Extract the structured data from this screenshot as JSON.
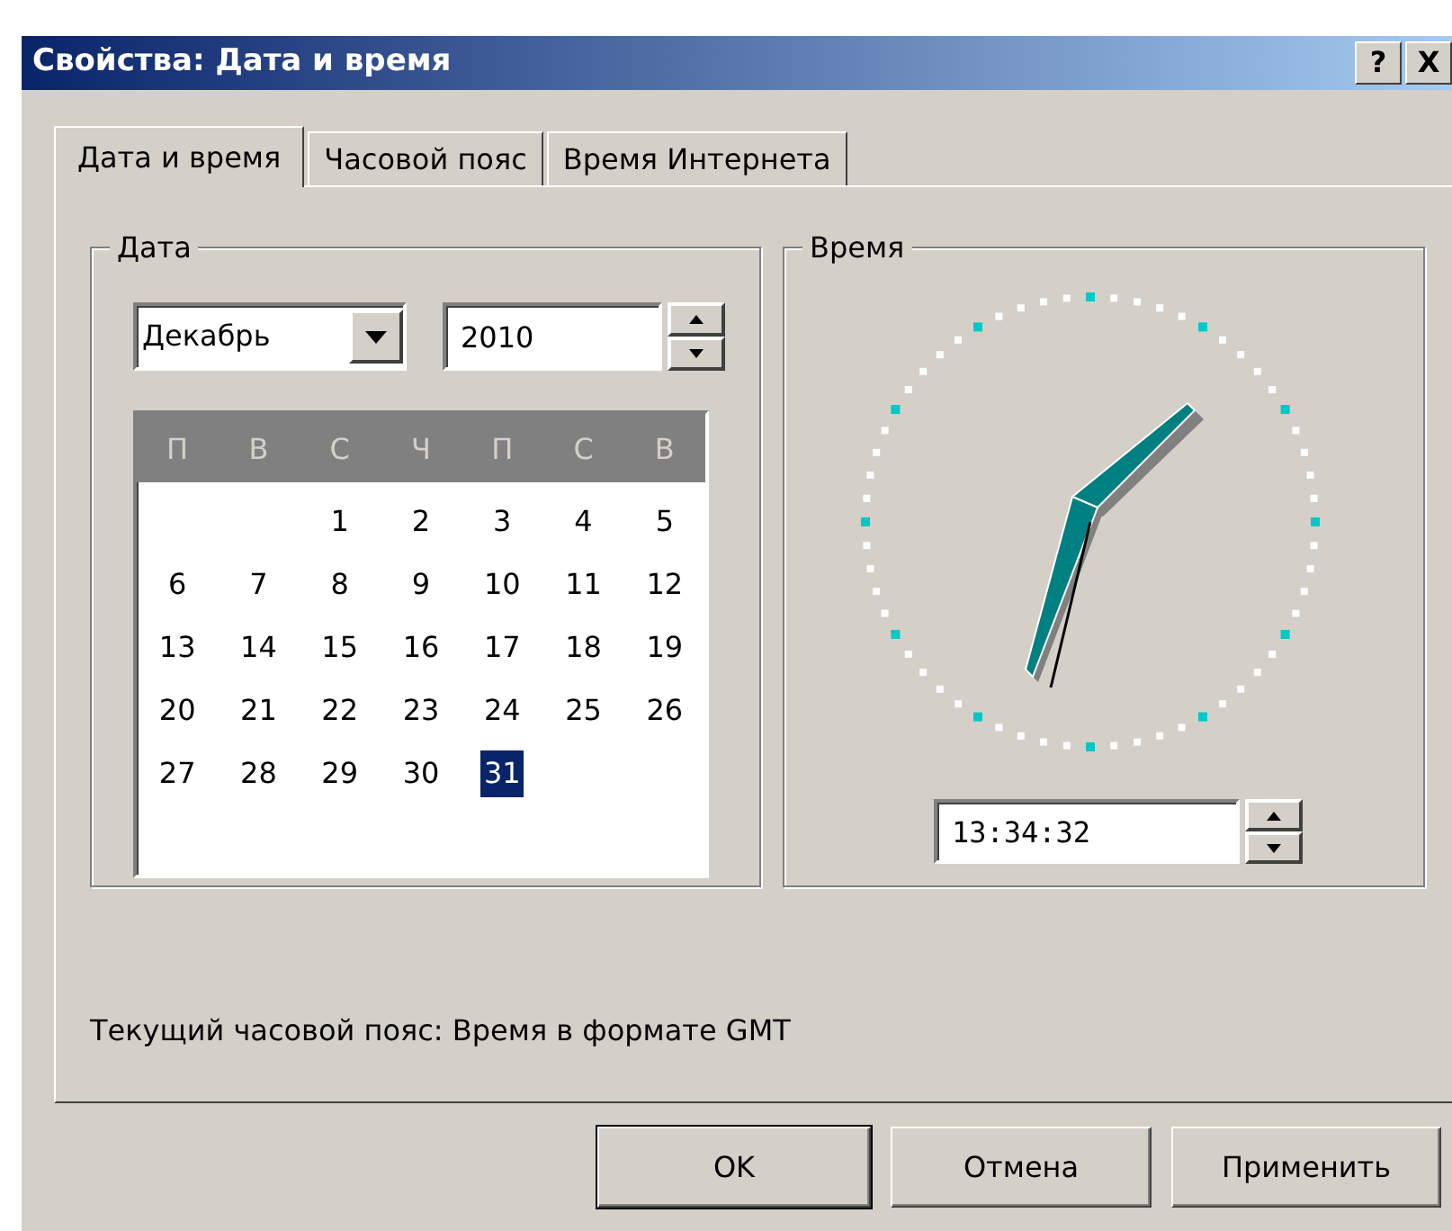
{
  "window": {
    "title": "Свойства: Дата и время",
    "title_buttons": [
      "?",
      "X"
    ]
  },
  "tabs": [
    {
      "label": "Дата и время",
      "selected": true
    },
    {
      "label": "Часовой пояс",
      "selected": false
    },
    {
      "label": "Время Интернета",
      "selected": false
    }
  ],
  "date_group": {
    "title": "Дата",
    "month": "Декабрь",
    "year": "2010",
    "weekdays": [
      "П",
      "В",
      "С",
      "Ч",
      "П",
      "С",
      "В"
    ],
    "weeks": [
      [
        {
          "day": "1",
          "selected": false
        },
        {
          "day": "2",
          "selected": false
        },
        {
          "day": "3",
          "selected": false
        },
        {
          "day": "4",
          "selected": false
        },
        {
          "day": "5",
          "selected": false
        }
      ],
      [
        {
          "day": "6",
          "selected": false
        },
        {
          "day": "7",
          "selected": false
        },
        {
          "day": "8",
          "selected": false
        },
        {
          "day": "9",
          "selected": false
        },
        {
          "day": "10",
          "selected": false
        },
        {
          "day": "11",
          "selected": false
        },
        {
          "day": "12",
          "selected": false
        }
      ],
      [
        {
          "day": "13",
          "selected": false
        },
        {
          "day": "14",
          "selected": false
        },
        {
          "day": "15",
          "selected": false
        },
        {
          "day": "16",
          "selected": false
        },
        {
          "day": "17",
          "selected": false
        },
        {
          "day": "18",
          "selected": false
        },
        {
          "day": "19",
          "selected": false
        }
      ],
      [
        {
          "day": "20",
          "selected": false
        },
        {
          "day": "21",
          "selected": false
        },
        {
          "day": "22",
          "selected": false
        },
        {
          "day": "23",
          "selected": false
        },
        {
          "day": "24",
          "selected": false
        },
        {
          "day": "25",
          "selected": false
        },
        {
          "day": "26",
          "selected": false
        }
      ],
      [
        {
          "day": "27",
          "selected": false
        },
        {
          "day": "28",
          "selected": false
        },
        {
          "day": "29",
          "selected": false
        },
        {
          "day": "30",
          "selected": false
        },
        {
          "day": "31",
          "selected": true
        }
      ]
    ]
  },
  "time_group": {
    "title": "Время",
    "time": "13:34:32"
  },
  "timezone_text": "Текущий часовой пояс: Время в формате GMT",
  "buttons": [
    {
      "label": "OK",
      "default": true
    },
    {
      "label": "Отмена",
      "default": false
    },
    {
      "label": "Применить",
      "default": false
    }
  ]
}
